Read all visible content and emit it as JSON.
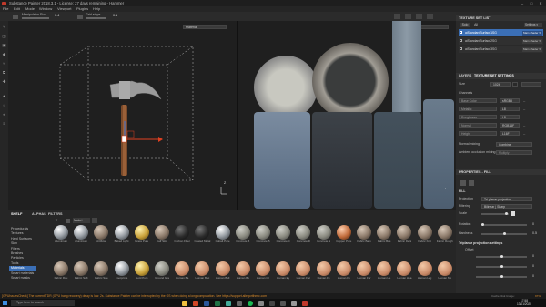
{
  "window": {
    "title": "Substance Painter 2018.3.1 - License: 27 days remaining - Hammer",
    "min": "–",
    "max": "□",
    "close": "✕"
  },
  "menu": [
    "File",
    "Edit",
    "Mode",
    "Window",
    "Viewport",
    "Plugins",
    "Help"
  ],
  "toolbar": {
    "manip_label": "Manipulator Size",
    "manip_value": "0.4",
    "grid_label": "Grid steps",
    "grid_value": "0.1"
  },
  "viewport3d": {
    "dropdown": "Material",
    "gizmo": "Z"
  },
  "viewport2d": {
    "dropdown": "Material"
  },
  "texture_set_list": {
    "title": "TEXTURE SET LIST",
    "tabs": [
      "Solo",
      "All"
    ],
    "settings": "Settings ▾",
    "items": [
      {
        "name": "aiStandardSurface1SG",
        "shader": "Main shader ▾"
      },
      {
        "name": "aiStandardSurface2SG",
        "shader": "Main shader ▾"
      },
      {
        "name": "aiStandardSurface3SG",
        "shader": "Main shader ▾"
      }
    ]
  },
  "ts_settings": {
    "tabs": [
      "LAYERS",
      "TEXTURE SET SETTINGS"
    ],
    "size_label": "Size",
    "size_value": "1024",
    "channels_label": "Channels",
    "channels": [
      {
        "name": "Base Color",
        "format": "sRGB8"
      },
      {
        "name": "Metallic",
        "format": "L8"
      },
      {
        "name": "Roughness",
        "format": "L8"
      },
      {
        "name": "Normal",
        "format": "RGB16F"
      },
      {
        "name": "Height",
        "format": "L16F"
      }
    ],
    "normal_mixing_label": "Normal mixing",
    "normal_mixing_value": "Combine",
    "ao_label": "Ambient occlusion mixing",
    "ao_value": "Multiply"
  },
  "properties": {
    "title": "PROPERTIES - FILL",
    "fill": "FILL",
    "projection_label": "Projection",
    "projection_value": "Tri-planar projection",
    "filtering_label": "Filtering",
    "filtering_value": "Bilinear | Sharp",
    "scale_label": "Scale",
    "rotation_label": "Rotation",
    "rotation_value": "0",
    "hardness_label": "Hardness",
    "hardness_value": "0.5",
    "triplanar_label": "Triplanar projection settings",
    "offset_label": "Offset",
    "offsets": [
      "0",
      "0",
      "0"
    ]
  },
  "shelf": {
    "tabs": [
      "SHELF",
      "ALPHAS",
      "FILTERS"
    ],
    "search": "Materi",
    "categories": [
      "Procedurals",
      "Textures",
      "Hard Surfaces",
      "Skin",
      "Filters",
      "Brushes",
      "Particles",
      "Tools",
      "Materials",
      "Smart materials",
      "Smart masks"
    ],
    "row1": [
      "Aluminium",
      "Aluminium",
      "Artificial",
      "Baked Light",
      "Brass Pure",
      "Calf Skin",
      "Carbon Fiber",
      "Coated Metal",
      "Cobalt Pure",
      "Concrete B",
      "Concrete B",
      "Concrete C",
      "Concrete D",
      "Concrete S",
      "Copper Pure",
      "Fabric Bam",
      "Fabric Bas",
      "Fabric Deni",
      "Fabric Knit",
      "Fabric Rough"
    ],
    "row2": [
      "Fabric Rou",
      "Fabric Soft",
      "Fabric Sue",
      "Footprints",
      "Gold Pure",
      "Ground Gra",
      "Human Ba",
      "Human Bac",
      "Human Bell",
      "Human Bu",
      "Human Ch",
      "Human Ey",
      "Human Fac",
      "Human Fe",
      "Human Fo",
      "Human For",
      "Human He",
      "Human Hea",
      "Human Leg",
      "Human Mo"
    ]
  },
  "status": "[GPUIssuesCheck] The current TDR (GPU hang recovery) delay is low: 2s. Substance Painter can be interrupted by the OS when doing a long computation. See https://support.allegorithmic.com",
  "taskbar": {
    "search_placeholder": "Type here to search",
    "time": "17:58",
    "date": "13/01/2020",
    "cache_label": "Cache Disk Usage:",
    "cache_value": "97%"
  },
  "colors": {
    "accent": "#3b6fb6",
    "status": "#d98a2a",
    "panel": "#2a2a2a"
  }
}
